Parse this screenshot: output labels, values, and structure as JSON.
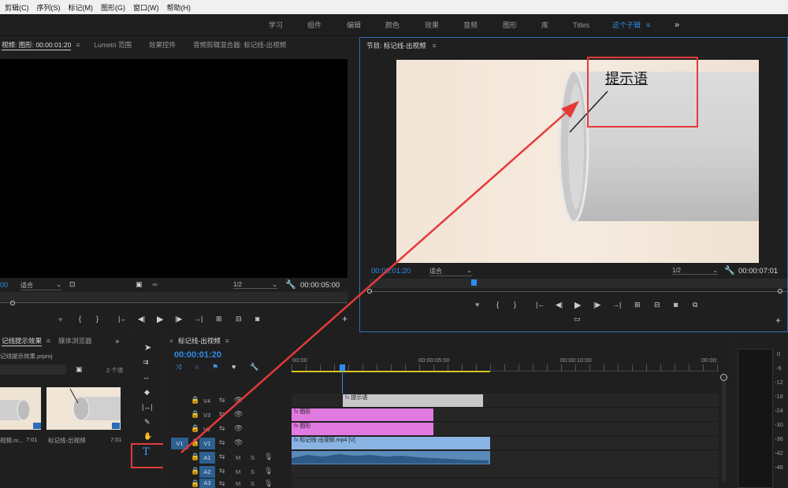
{
  "menu": [
    "剪辑(C)",
    "序列(S)",
    "标记(M)",
    "图形(G)",
    "窗口(W)",
    "帮助(H)"
  ],
  "workspaces": [
    "学习",
    "组件",
    "编辑",
    "颜色",
    "效果",
    "音频",
    "图形",
    "库",
    "Titles",
    "这个子辑"
  ],
  "workspace_active": "这个子辑",
  "source": {
    "tabs": [
      "视频: 图形: 00:00:01:20",
      "Lumetri 范围",
      "效果控件",
      "音频剪辑混合器: 标记线-出视频"
    ],
    "timecode_left": "00",
    "fit": "适合",
    "resolution": "1/2",
    "duration": "00:00:05:00"
  },
  "program": {
    "title": "节目: 标记线-出视频",
    "timecode": "00:00:01:20",
    "fit": "适合",
    "resolution": "1/2",
    "duration": "00:00:07:01",
    "overlay_text": "提示语"
  },
  "project": {
    "tabs": [
      "记线提示效果",
      "媒体浏览器"
    ],
    "file": "记线提示效果.prproj",
    "count": "2 个项",
    "items": [
      {
        "label": "视频.m...",
        "duration": "7:01"
      },
      {
        "label": "标记线-出视频",
        "duration": "7:01"
      }
    ]
  },
  "timeline": {
    "title": "标记线-出视频",
    "timecode": "00:00:01:20",
    "ruler": [
      "00:00",
      "00:00:05:00",
      "00:00:10:00",
      "00:00:"
    ],
    "tracks": [
      "V4",
      "V3",
      "V2",
      "V1",
      "A1",
      "A2",
      "A3"
    ],
    "source_patch": "V1",
    "clips": {
      "v4": "提示语",
      "v3": "图形",
      "v2": "图形",
      "v1": "标记线-出视频.mp4 [V]"
    }
  },
  "meter": [
    "0",
    "-6",
    "-12",
    "-18",
    "-24",
    "-30",
    "-36",
    "-42",
    "-48"
  ],
  "colors": {
    "accent": "#2d8ceb",
    "annotation": "#e53a3a",
    "graphic_clip": "#e07ae0",
    "video_clip": "#8ab4e3",
    "audio_clip": "#5a8ab8",
    "title_clip": "#c8c8c8"
  }
}
